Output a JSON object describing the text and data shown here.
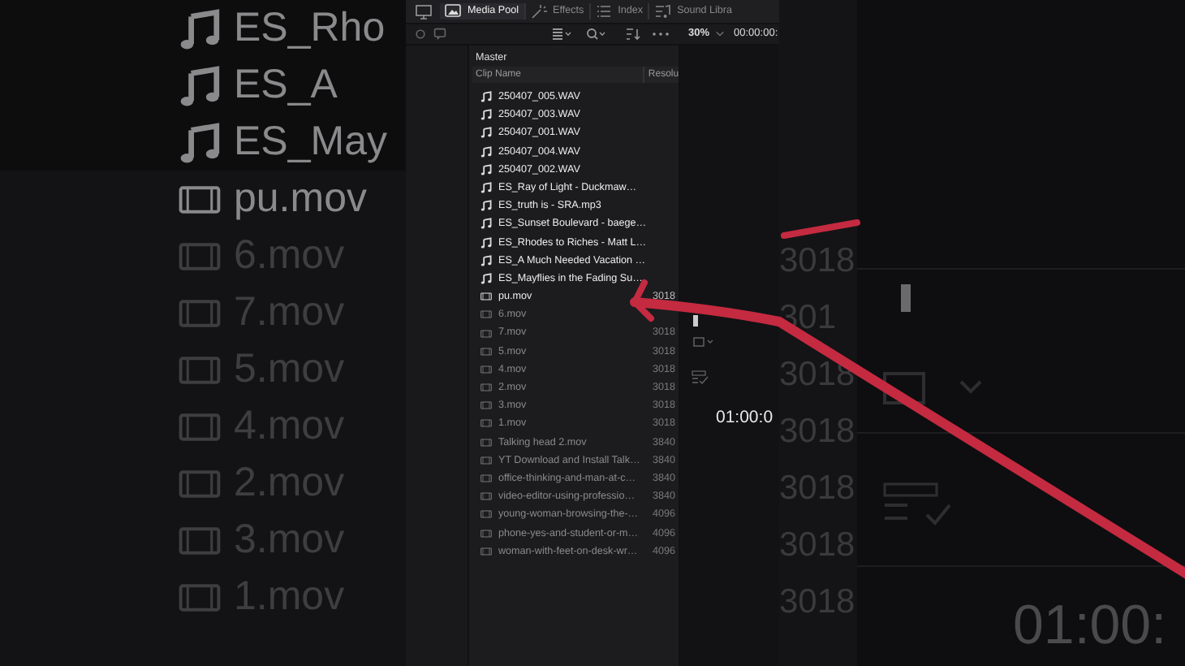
{
  "backdrop_left": {
    "clips": [
      {
        "kind": "audio",
        "name": "ES_Rho",
        "dimmed": false
      },
      {
        "kind": "audio",
        "name": "ES_A",
        "dimmed": false
      },
      {
        "kind": "audio",
        "name": "ES_May",
        "dimmed": false
      },
      {
        "kind": "video",
        "name": "pu.mov",
        "dimmed": false
      },
      {
        "kind": "video",
        "name": "6.mov",
        "dimmed": true
      },
      {
        "kind": "video",
        "name": "7.mov",
        "dimmed": true
      },
      {
        "kind": "video",
        "name": "5.mov",
        "dimmed": true
      },
      {
        "kind": "video",
        "name": "4.mov",
        "dimmed": true
      },
      {
        "kind": "video",
        "name": "2.mov",
        "dimmed": true
      },
      {
        "kind": "video",
        "name": "3.mov",
        "dimmed": true
      },
      {
        "kind": "video",
        "name": "1.mov",
        "dimmed": true
      }
    ]
  },
  "toolbar": {
    "tabs": [
      {
        "kind": "media",
        "label": "Media Pool",
        "selected": true
      },
      {
        "kind": "effects",
        "label": "Effects",
        "selected": false
      },
      {
        "kind": "index",
        "label": "Index",
        "selected": false
      },
      {
        "kind": "sound",
        "label": "Sound Libra",
        "selected": false
      }
    ]
  },
  "viewer_bar": {
    "zoom": "30%",
    "timecode": "00:00:00:"
  },
  "media_pool": {
    "bin": "Master",
    "columns": [
      "Clip Name",
      "Resolu"
    ],
    "clips": [
      {
        "kind": "audio",
        "name": "250407_005.WAV",
        "dimmed": false
      },
      {
        "kind": "audio",
        "name": "250407_003.WAV",
        "dimmed": false
      },
      {
        "kind": "audio",
        "name": "250407_001.WAV",
        "dimmed": false
      },
      {
        "kind": "audio",
        "name": "250407_004.WAV",
        "dimmed": false
      },
      {
        "kind": "audio",
        "name": "250407_002.WAV",
        "dimmed": false
      },
      {
        "kind": "audio",
        "name": "ES_Ray of Light - Duckmaw…",
        "dimmed": false
      },
      {
        "kind": "audio",
        "name": "ES_truth is - SRA.mp3",
        "dimmed": false
      },
      {
        "kind": "audio",
        "name": "ES_Sunset Boulevard - baege…",
        "dimmed": false
      },
      {
        "kind": "audio",
        "name": "ES_Rhodes to Riches - Matt L…",
        "dimmed": false
      },
      {
        "kind": "audio",
        "name": "ES_A Much Needed Vacation …",
        "dimmed": false
      },
      {
        "kind": "audio",
        "name": "ES_Mayflies in the Fading Su…",
        "dimmed": false
      },
      {
        "kind": "video",
        "name": "pu.mov",
        "resolution": "3018",
        "dimmed": false
      },
      {
        "kind": "video",
        "name": "6.mov",
        "dimmed": true
      },
      {
        "kind": "video",
        "name": "7.mov",
        "resolution": "3018",
        "dimmed": true
      },
      {
        "kind": "video",
        "name": "5.mov",
        "resolution": "3018",
        "dimmed": true
      },
      {
        "kind": "video",
        "name": "4.mov",
        "resolution": "3018",
        "dimmed": true
      },
      {
        "kind": "video",
        "name": "2.mov",
        "resolution": "3018",
        "dimmed": true
      },
      {
        "kind": "video",
        "name": "3.mov",
        "resolution": "3018",
        "dimmed": true
      },
      {
        "kind": "video",
        "name": "1.mov",
        "resolution": "3018",
        "dimmed": true
      },
      {
        "kind": "video",
        "name": "Talking head 2.mov",
        "resolution": "3840",
        "dimmed": true
      },
      {
        "kind": "video",
        "name": "YT Download and Install Talk…",
        "resolution": "3840",
        "dimmed": true
      },
      {
        "kind": "video",
        "name": "office-thinking-and-man-at-c…",
        "resolution": "3840",
        "dimmed": true
      },
      {
        "kind": "video",
        "name": "video-editor-using-professio…",
        "resolution": "3840",
        "dimmed": true
      },
      {
        "kind": "video",
        "name": "young-woman-browsing-the-…",
        "resolution": "4096",
        "dimmed": true
      },
      {
        "kind": "video",
        "name": "phone-yes-and-student-or-m…",
        "resolution": "4096",
        "dimmed": true
      },
      {
        "kind": "video",
        "name": "woman-with-feet-on-desk-wr…",
        "resolution": "4096",
        "dimmed": true
      }
    ]
  },
  "viewer": {
    "timecode": "01:00:0"
  },
  "backdrop_right": {
    "resolutions": [
      "3018",
      "301",
      "3018",
      "3018",
      "3018",
      "3018",
      "3018"
    ],
    "timecode": "01:00:"
  }
}
